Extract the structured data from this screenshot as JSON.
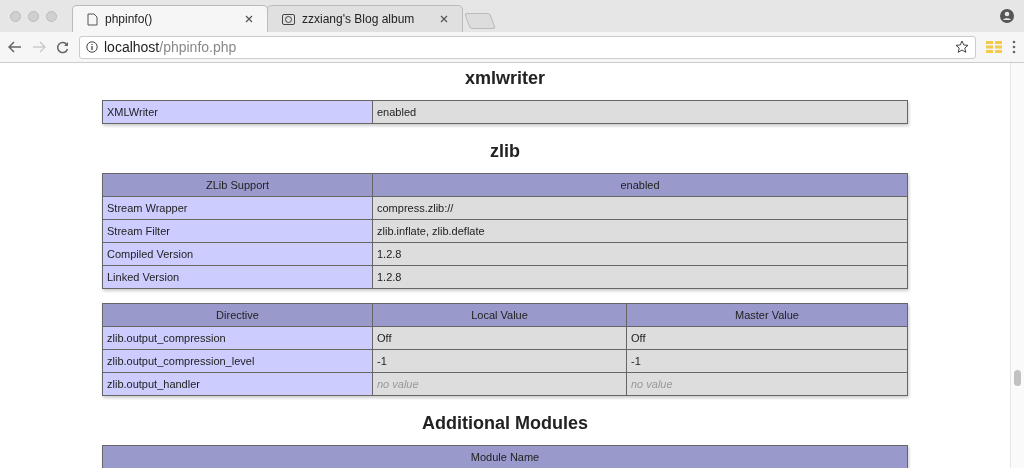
{
  "tabs": [
    {
      "title": "phpinfo()",
      "kind": "page",
      "selected": true
    },
    {
      "title": "zzxiang's Blog album",
      "kind": "photo",
      "selected": false
    }
  ],
  "address": {
    "host": "localhost",
    "path": "/phpinfo.php"
  },
  "sections": [
    {
      "title": "xmlwriter",
      "tables": [
        {
          "rows": [
            {
              "name": "XMLWriter",
              "values": [
                "enabled"
              ],
              "no_value": false
            }
          ]
        }
      ]
    },
    {
      "title": "zlib",
      "tables": [
        {
          "header": [
            "ZLib Support",
            "enabled"
          ],
          "rows": [
            {
              "name": "Stream Wrapper",
              "values": [
                "compress.zlib://"
              ],
              "no_value": false
            },
            {
              "name": "Stream Filter",
              "values": [
                "zlib.inflate, zlib.deflate"
              ],
              "no_value": false
            },
            {
              "name": "Compiled Version",
              "values": [
                "1.2.8"
              ],
              "no_value": false
            },
            {
              "name": "Linked Version",
              "values": [
                "1.2.8"
              ],
              "no_value": false
            }
          ]
        },
        {
          "header": [
            "Directive",
            "Local Value",
            "Master Value"
          ],
          "rows": [
            {
              "name": "zlib.output_compression",
              "values": [
                "Off",
                "Off"
              ],
              "no_value": false
            },
            {
              "name": "zlib.output_compression_level",
              "values": [
                "-1",
                "-1"
              ],
              "no_value": false
            },
            {
              "name": "zlib.output_handler",
              "values": [
                "no value",
                "no value"
              ],
              "no_value": true
            }
          ]
        }
      ]
    },
    {
      "title": "Additional Modules",
      "tables": [
        {
          "header": [
            "Module Name"
          ]
        }
      ]
    }
  ]
}
